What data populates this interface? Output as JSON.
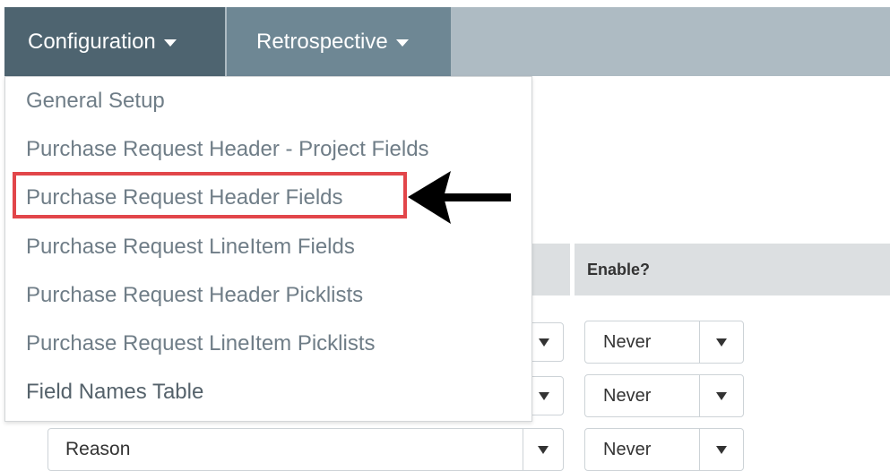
{
  "navbar": {
    "tabs": [
      {
        "label": "Configuration"
      },
      {
        "label": "Retrospective"
      }
    ]
  },
  "menu": {
    "items": [
      {
        "label": "General Setup"
      },
      {
        "label": "Purchase Request Header - Project Fields"
      },
      {
        "label": "Purchase Request Header Fields"
      },
      {
        "label": "Purchase Request LineItem Fields"
      },
      {
        "label": "Purchase Request Header Picklists"
      },
      {
        "label": "Purchase Request LineItem Picklists"
      },
      {
        "label": "Field Names Table"
      }
    ],
    "highlighted_index": 2
  },
  "table": {
    "enable_header": "Enable?",
    "rows": [
      {
        "enable_value": "Never"
      },
      {
        "enable_value": "Never"
      },
      {
        "field_value": "Reason",
        "enable_value": "Never"
      }
    ]
  },
  "colors": {
    "nav_active": "#4e6470",
    "nav_inactive": "#6e8794",
    "nav_bar": "#aebbc3",
    "highlight": "#e2464a",
    "menu_text": "#6f7d87"
  },
  "icons": {
    "nav_caret": "caret-down-icon",
    "select_arrow": "triangle-down-icon",
    "annotation": "arrow-left-icon"
  }
}
